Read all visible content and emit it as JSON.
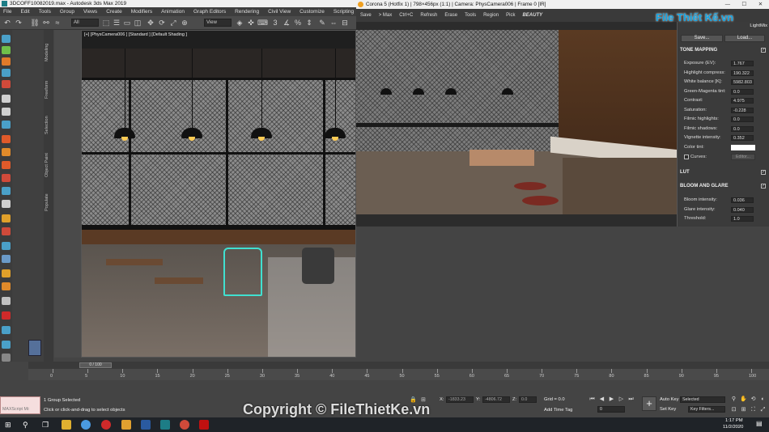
{
  "app_title": "3DCOFF10082019.max - Autodesk 3ds Max 2019",
  "menu": [
    "File",
    "Edit",
    "Tools",
    "Group",
    "Views",
    "Create",
    "Modifiers",
    "Animation",
    "Graph Editors",
    "Rendering",
    "Civil View",
    "Customize",
    "Scripting"
  ],
  "toolbar": {
    "selection_filter": "All",
    "ref_coord": "View"
  },
  "command_tabs": [
    "Modeling",
    "Freeform",
    "Selection",
    "Object Paint",
    "Populate"
  ],
  "viewport": {
    "label": "[+] [PhysCamera006 ] [Standard ] [Default Shading ]"
  },
  "render_window": {
    "title": "Corona 5 (Hotfix 1) | 798×456px (1:1) | Camera: PhysCamera006 | Frame 0 [IR]",
    "toolbar": [
      "Save",
      "> Max",
      "Ctrl+C",
      "Refresh",
      "Erase",
      "Tools",
      "Region",
      "Pick",
      "BEAUTY"
    ],
    "lightmix_tab": "LightMix",
    "save_btn": "Save...",
    "load_btn": "Load...",
    "tone_mapping_title": "TONE MAPPING",
    "params": [
      {
        "label": "Exposure (EV):",
        "value": "1.767"
      },
      {
        "label": "Highlight compress:",
        "value": "190.322"
      },
      {
        "label": "White balance [K]:",
        "value": "5982.803"
      },
      {
        "label": "Green-Magenta tint:",
        "value": "0.0"
      },
      {
        "label": "Contrast:",
        "value": "4.975"
      },
      {
        "label": "Saturation:",
        "value": "-0.228"
      },
      {
        "label": "Filmic highlights:",
        "value": "0.0"
      },
      {
        "label": "Filmic shadows:",
        "value": "0.0"
      },
      {
        "label": "Vignette intensity:",
        "value": "0.352"
      }
    ],
    "color_tint_label": "Color tint:",
    "curves_label": "Curves:",
    "curves_btn": "Editor...",
    "lut_title": "LUT",
    "bloom_title": "BLOOM AND GLARE",
    "bloom_params": [
      {
        "label": "Bloom intensity:",
        "value": "0.036"
      },
      {
        "label": "Glare intensity:",
        "value": "0.040"
      },
      {
        "label": "Threshold:",
        "value": "1.0"
      }
    ]
  },
  "timeline": {
    "slider": "0 / 100",
    "ticks": [
      "0",
      "5",
      "10",
      "15",
      "20",
      "25",
      "30",
      "35",
      "40",
      "45",
      "50",
      "55",
      "60",
      "65",
      "70",
      "75",
      "80",
      "85",
      "90",
      "95",
      "100"
    ]
  },
  "status": {
    "script_label": "MAXScript Mi:",
    "selected": "1 Group Selected",
    "prompt": "Click or click-and-drag to select objects",
    "x_label": "X:",
    "x_val": "-1833.23",
    "y_label": "Y:",
    "y_val": "-4806.72",
    "z_label": "Z:",
    "z_val": "0.0",
    "grid": "Grid = 0.0",
    "add_time_tag": "Add Time Tag",
    "frame": "0",
    "auto_key": "Auto Key",
    "selected_dd": "Selected",
    "set_key": "Set Key",
    "key_filters": "Key Filters..."
  },
  "taskbar": {
    "time": "1:17 PM",
    "date": "11/2/2020"
  },
  "watermark": "Copyright © FileThietKe.vn",
  "logo": "File Thiết Kế.vn",
  "colors": {
    "accent": "#1d7d86",
    "selection": "#40e0d0",
    "ui_dark": "#3d3d3d"
  }
}
